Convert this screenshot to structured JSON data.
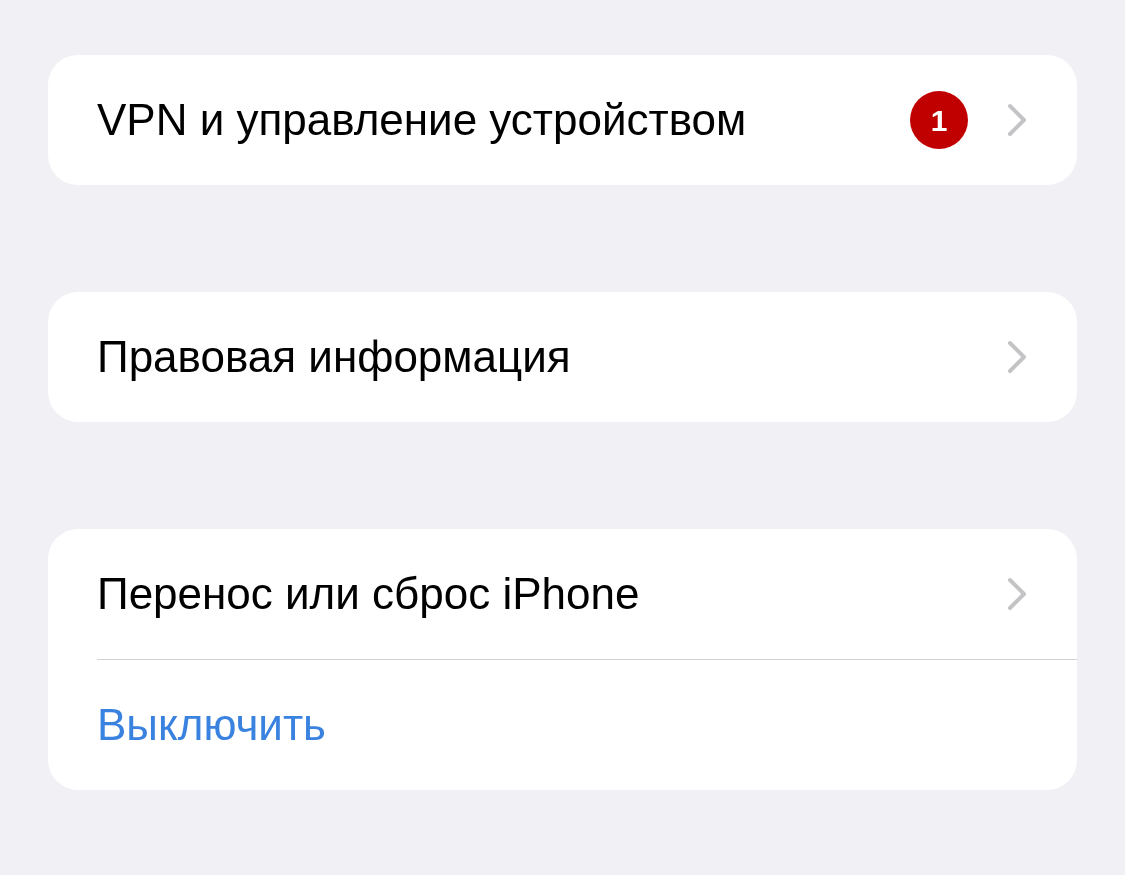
{
  "sections": [
    {
      "rows": [
        {
          "kind": "nav",
          "label": "VPN и управление устройством",
          "badge": "1"
        }
      ]
    },
    {
      "rows": [
        {
          "kind": "nav",
          "label": "Правовая информация"
        }
      ]
    },
    {
      "rows": [
        {
          "kind": "nav",
          "label": "Перенос или сброс iPhone"
        },
        {
          "kind": "action",
          "label": "Выключить"
        }
      ]
    }
  ]
}
